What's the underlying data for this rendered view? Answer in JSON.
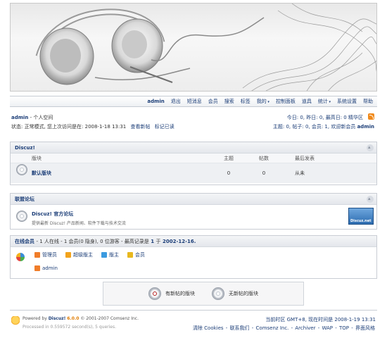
{
  "nav": {
    "items": [
      "admin",
      "退出",
      "短消息",
      "会员",
      "搜索",
      "标签",
      "我的",
      "控制面板",
      "道具",
      "统计",
      "系统设置",
      "帮助"
    ]
  },
  "user": {
    "name": "admin",
    "space": "- 个人空间",
    "status": "状态: 正常模式, 您上次访问是在: 2008-1-18 13:31",
    "view_new": "查看新帖",
    "mark_read": "标记已读",
    "today_stats": "今日: 0, 昨日: 0, 最高日: 0",
    "digest": "精华区",
    "totals": "主题: 0, 帖子: 0, 会员: 1, 欢迎新会员",
    "newest_member": "admin"
  },
  "forum_box": {
    "title": "Discuz!",
    "columns": [
      "版块",
      "主题",
      "帖数",
      "最后发表"
    ],
    "rows": [
      {
        "name": "默认版块",
        "topics": "0",
        "posts": "0",
        "last": "从未"
      }
    ]
  },
  "links_box": {
    "title": "联盟论坛",
    "name": "Discuz! 官方论坛",
    "desc": "提供最新 Discuz! 产品新闻、软件下载与技术交流",
    "logo_text": "Discuz.net"
  },
  "online_box": {
    "title": "在线会员",
    "summary": "- 1 人在线 - 1 会员(0 隐身), 0 位游客 - 最高记录是",
    "max": "1",
    "at": "于",
    "date": "2002-12-16.",
    "legend": [
      {
        "label": "管理员",
        "color": "#f07d2a"
      },
      {
        "label": "超级版主",
        "color": "#f2a31c"
      },
      {
        "label": "版主",
        "color": "#3b9be0"
      },
      {
        "label": "会员",
        "color": "#e8b81f"
      }
    ],
    "online_users": [
      "admin"
    ]
  },
  "new_legend": {
    "new": "有新帖的版块",
    "none": "无新帖的版块"
  },
  "footer": {
    "powered": "Powered by",
    "product": "Discuz!",
    "version": "6.0.0",
    "copyright": "© 2001-2007 Comsenz Inc.",
    "processed": "Processed in 0.559572 second(s), 5 queries.",
    "time": "当前时区 GMT+8, 现在时间是 2008-1-19 13:31",
    "links": [
      "清除 Cookies",
      "联系我们",
      "Comsenz Inc.",
      "Archiver",
      "WAP",
      "TOP",
      "界面风格"
    ]
  },
  "colors": {
    "link": "#1b3d77",
    "border": "#c9cdd4",
    "header_bg": "#e4e7ec"
  }
}
